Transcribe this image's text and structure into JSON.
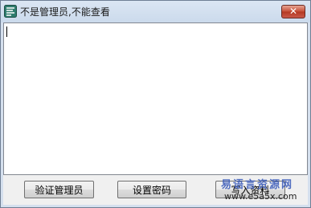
{
  "window": {
    "title": "不是管理员,不能查看",
    "close_label": "✕"
  },
  "content": {
    "text_value": ""
  },
  "buttons": {
    "verify_admin": "验证管理员",
    "set_password": "设置密码",
    "write_data": "写入资料"
  },
  "watermark": {
    "site_name": "易语言资源网",
    "site_url": "www.e5a5x.com"
  },
  "colors": {
    "titlebar": "#d5e0ee",
    "close_button": "#c7513a",
    "client_background": "#f0f0f0",
    "watermark": "#3557b8"
  }
}
